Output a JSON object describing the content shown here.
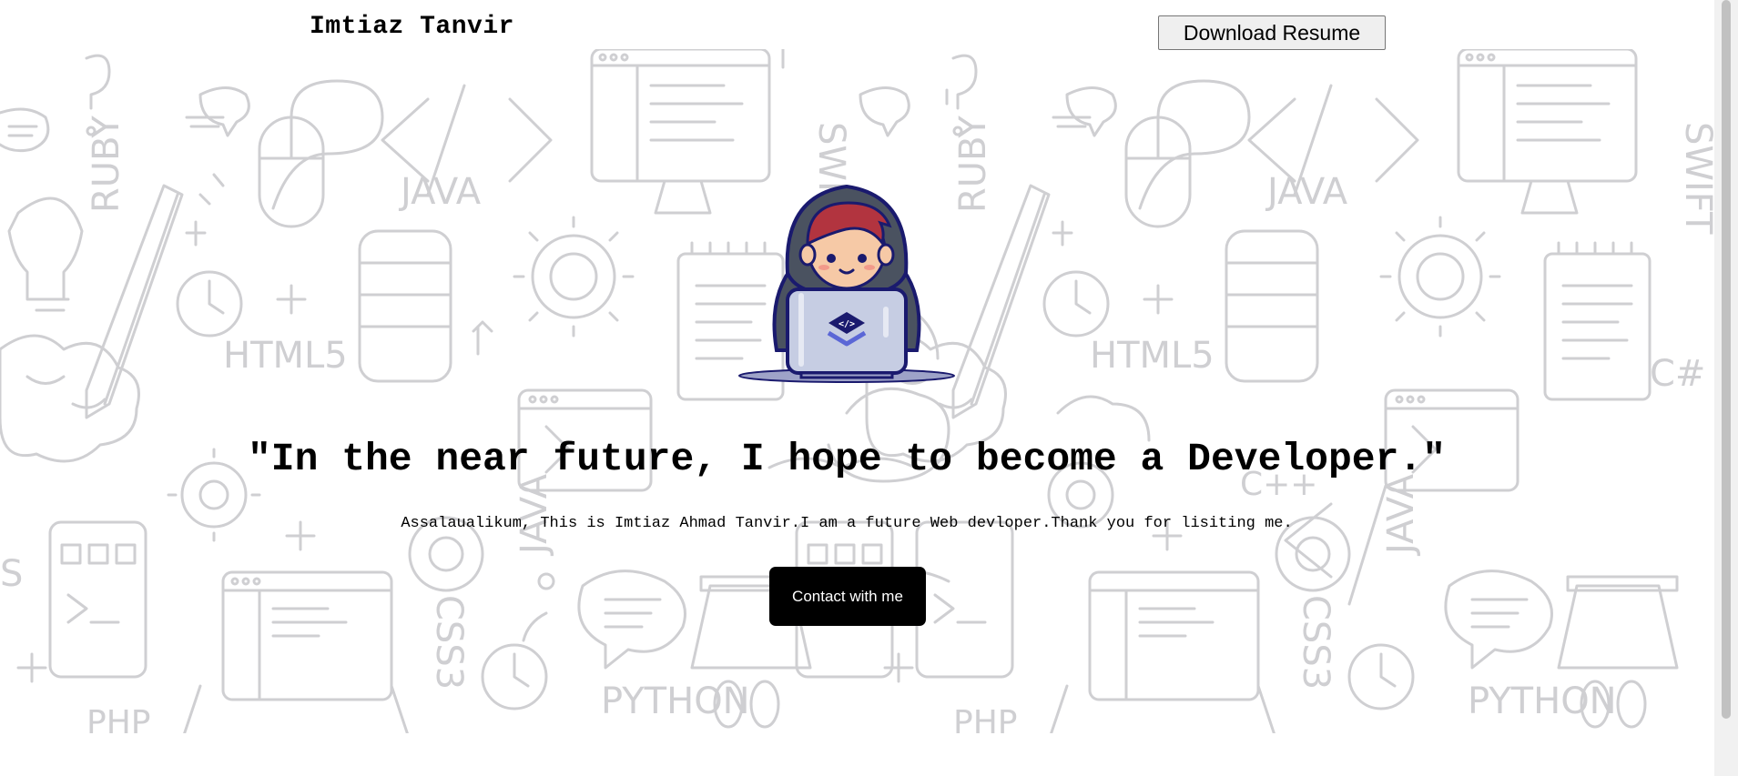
{
  "header": {
    "brand": "Imtiaz Tanvir",
    "resume_button": "Download Resume"
  },
  "hero": {
    "background_doodle_labels": [
      "RUBY",
      "JAVA",
      "SWIFT",
      "HTML5",
      "PYTHON",
      "CSS3",
      "C++",
      "C#",
      "PHP",
      "JAVA"
    ],
    "avatar_icon": "developer-with-laptop-illustration",
    "headline": "\"In the near future, I hope to become a Developer.\"",
    "intro": "Assalaualikum, This is Imtiaz Ahmad Tanvir.I am a future Web devloper.Thank you for lisiting me.",
    "contact_button": "Contact with me"
  },
  "colors": {
    "button_primary": "#000000",
    "button_primary_text": "#ffffff",
    "doodle_stroke": "#cfcfd2",
    "hoodie": "#4a5260",
    "hair": "#b2343f",
    "laptop": "#c6cde3",
    "outline": "#1a1a6e"
  }
}
